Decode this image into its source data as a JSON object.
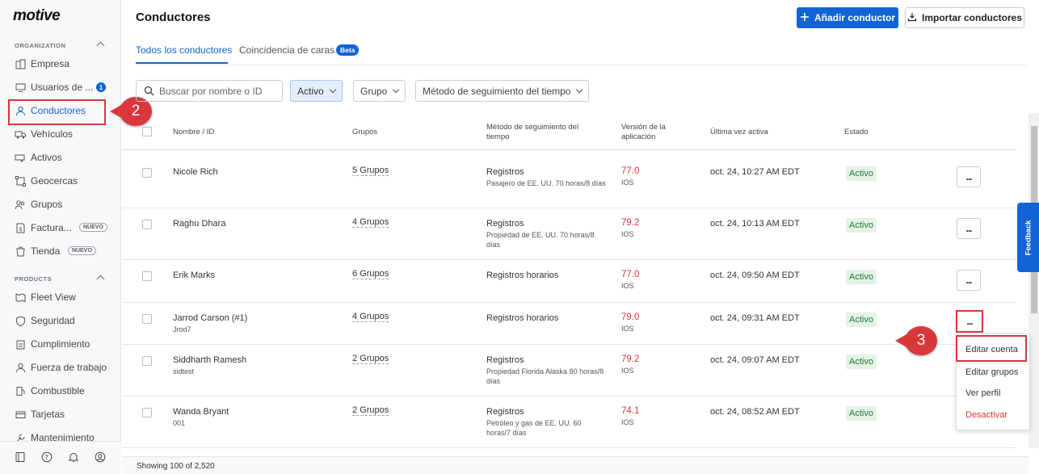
{
  "brand": {
    "logo": "motive"
  },
  "sidebar": {
    "organization_label": "ORGANIZATION",
    "products_label": "PRODUCTS",
    "org_items": [
      {
        "label": "Empresa",
        "icon": "building-icon"
      },
      {
        "label": "Usuarios de ...",
        "icon": "monitor-icon",
        "count": "1"
      },
      {
        "label": "Conductores",
        "icon": "person-icon"
      },
      {
        "label": "Vehículos",
        "icon": "truck-icon"
      },
      {
        "label": "Activos",
        "icon": "trailer-icon"
      },
      {
        "label": "Geocercas",
        "icon": "geofence-icon"
      },
      {
        "label": "Grupos",
        "icon": "group-icon"
      },
      {
        "label": "Factura...",
        "icon": "invoice-icon",
        "tag": "NUEVO"
      },
      {
        "label": "Tienda",
        "icon": "store-icon",
        "tag": "NUEVO"
      }
    ],
    "product_items": [
      {
        "label": "Fleet View",
        "icon": "map-icon"
      },
      {
        "label": "Seguridad",
        "icon": "shield-icon"
      },
      {
        "label": "Cumplimiento",
        "icon": "clipboard-icon"
      },
      {
        "label": "Fuerza de trabajo",
        "icon": "person-icon"
      },
      {
        "label": "Combustible",
        "icon": "fuel-icon"
      },
      {
        "label": "Tarjetas",
        "icon": "card-icon"
      },
      {
        "label": "Mantenimiento",
        "icon": "wrench-icon"
      }
    ],
    "footer_icons": [
      "book-icon",
      "help-icon",
      "bell-icon",
      "user-circle-icon"
    ]
  },
  "header": {
    "title": "Conductores",
    "add_button": "Añadir conductor",
    "import_button": "Importar conductores"
  },
  "tabs": [
    {
      "label": "Todos los conductores",
      "selected": true
    },
    {
      "label": "Coincidencia de caras",
      "badge": "Beta"
    }
  ],
  "filters": {
    "search_placeholder": "Buscar por nombre o ID",
    "status": "Activo",
    "group": "Grupo",
    "tracking": "Método de seguimiento del tiempo"
  },
  "table": {
    "columns": {
      "name": "Nombre / ID",
      "groups": "Grupos",
      "method": "Método de seguimiento del tiempo",
      "version": "Versión de la aplicación",
      "last_active": "Última vez activa",
      "status": "Estado"
    },
    "rows": [
      {
        "name": "Nicole Rich",
        "id": "",
        "groups": "5 Grupos",
        "method": "Registros",
        "method_sub": "Pasajero de EE. UU. 70 horas/8 días",
        "version": "77.0",
        "platform": "IOS",
        "last": "oct. 24, 10:27 AM EDT",
        "status": "Activo"
      },
      {
        "name": "Raghu Dhara",
        "id": "",
        "groups": "4 Grupos",
        "method": "Registros",
        "method_sub": "Propiedad de EE. UU. 70 horas/8 días",
        "version": "79.2",
        "platform": "IOS",
        "last": "oct. 24, 10:13 AM EDT",
        "status": "Activo"
      },
      {
        "name": "Erik Marks",
        "id": "",
        "groups": "6 Grupos",
        "method": "Registros horarios",
        "method_sub": "",
        "version": "77.0",
        "platform": "IOS",
        "last": "oct. 24, 09:50 AM EDT",
        "status": "Activo"
      },
      {
        "name": "Jarrod Carson (#1)",
        "id": "Jrod7",
        "groups": "4 Grupos",
        "method": "Registros horarios",
        "method_sub": "",
        "version": "79.0",
        "platform": "IOS",
        "last": "oct. 24, 09:31 AM EDT",
        "status": "Activo"
      },
      {
        "name": "Siddharth Ramesh",
        "id": "sidtest",
        "groups": "2 Grupos",
        "method": "Registros",
        "method_sub": "Propiedad Florida Alaska 80 horas/8 días",
        "version": "79.2",
        "platform": "IOS",
        "last": "oct. 24, 09:07 AM EDT",
        "status": "Activo"
      },
      {
        "name": "Wanda Bryant",
        "id": "001",
        "groups": "2 Grupos",
        "method": "Registros",
        "method_sub": "Petróleo y gas de EE. UU. 60 horas/7 días",
        "version": "74.1",
        "platform": "IOS",
        "last": "oct. 24, 08:52 AM EDT",
        "status": "Activo"
      }
    ],
    "more_label": "...",
    "footer": "Showing 100 of 2,520"
  },
  "context_menu": [
    "Editar cuenta",
    "Editar grupos",
    "Ver perfil",
    "Desactivar"
  ],
  "feedback": "Feedback",
  "callouts": {
    "step2": "2",
    "step3": "3"
  },
  "colors": {
    "primary": "#1264d6",
    "danger": "#d8373b",
    "success_bg": "#e4f3e6",
    "success_text": "#227a33"
  }
}
